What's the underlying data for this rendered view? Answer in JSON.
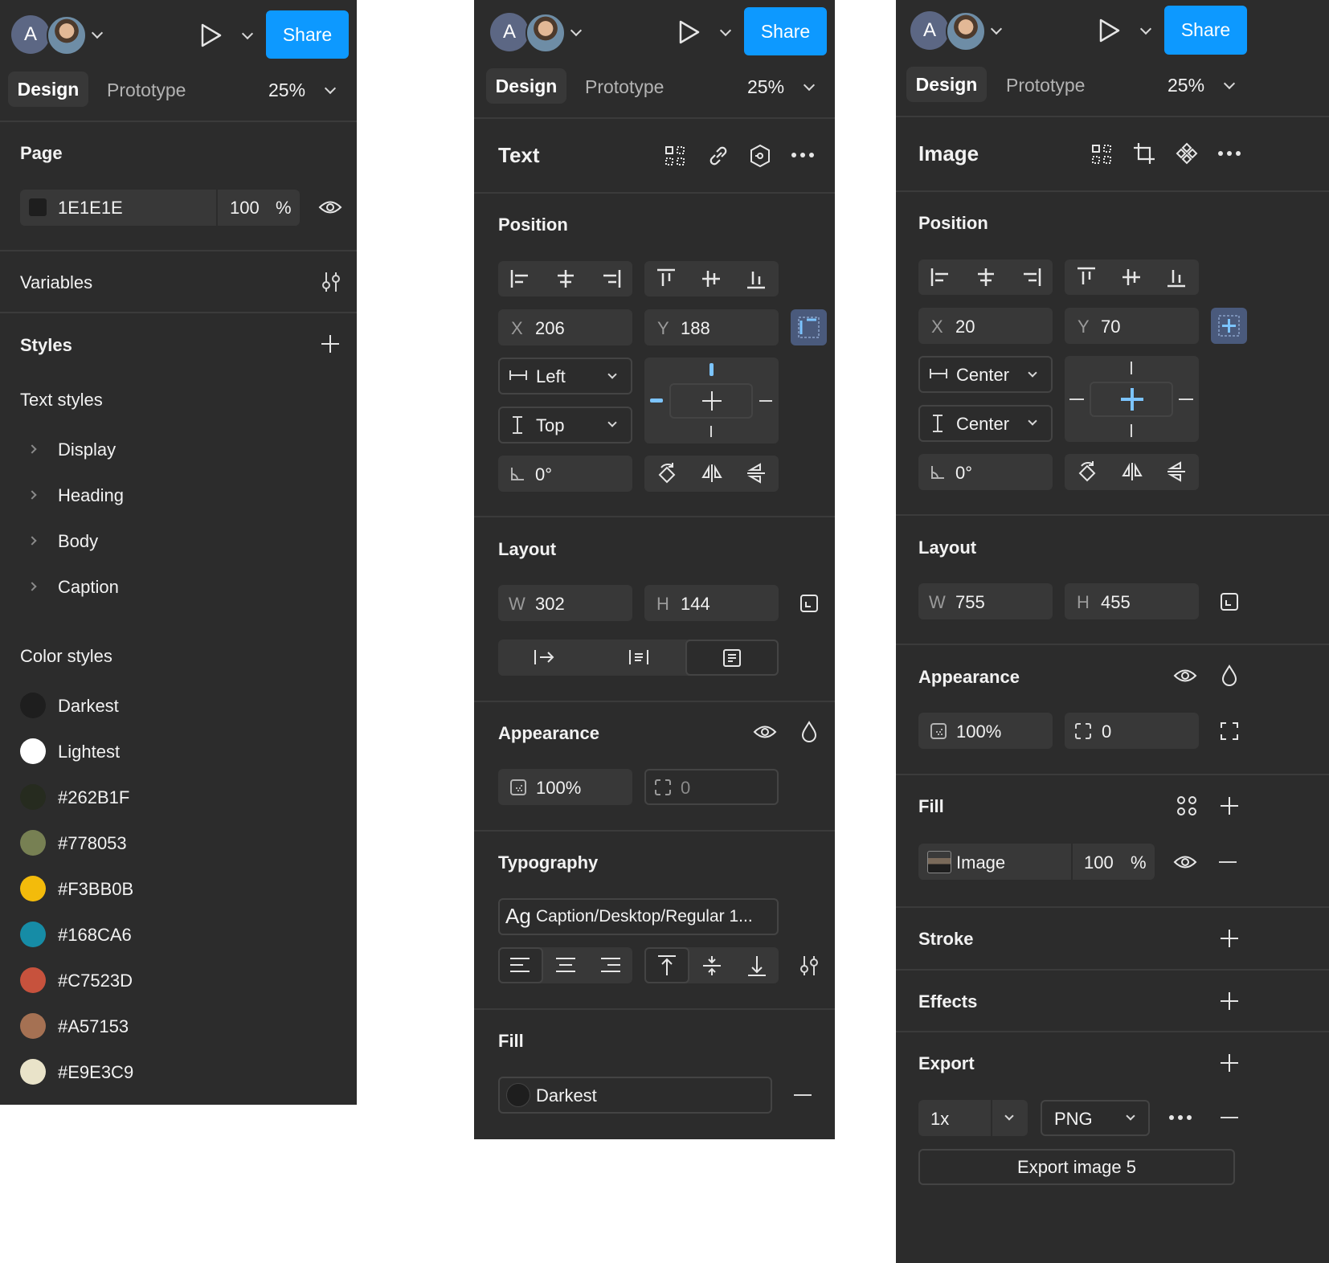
{
  "header": {
    "avatar_initial": "A",
    "share_label": "Share",
    "tabs": [
      "Design",
      "Prototype"
    ],
    "zoom": "25%"
  },
  "panel1": {
    "page_title": "Page",
    "page_color": "1E1E1E",
    "page_opacity": "100",
    "percent": "%",
    "variables": "Variables",
    "styles": "Styles",
    "text_styles_title": "Text styles",
    "text_styles": [
      "Display",
      "Heading",
      "Body",
      "Caption"
    ],
    "color_styles_title": "Color styles",
    "color_styles": [
      {
        "name": "Darkest",
        "color": "#1e1e1e"
      },
      {
        "name": "Lightest",
        "color": "#ffffff"
      },
      {
        "name": "#262B1F",
        "color": "#262B1F"
      },
      {
        "name": "#778053",
        "color": "#778053"
      },
      {
        "name": "#F3BB0B",
        "color": "#F3BB0B"
      },
      {
        "name": "#168CA6",
        "color": "#168CA6"
      },
      {
        "name": "#C7523D",
        "color": "#C7523D"
      },
      {
        "name": "#A57153",
        "color": "#A57153"
      },
      {
        "name": "#E9E3C9",
        "color": "#E9E3C9"
      }
    ]
  },
  "panel2": {
    "title": "Text",
    "position": "Position",
    "x_label": "X",
    "x_value": "206",
    "y_label": "Y",
    "y_value": "188",
    "h_constraint": "Left",
    "v_constraint": "Top",
    "rotation": "0°",
    "layout": "Layout",
    "w_label": "W",
    "w_value": "302",
    "h_label": "H",
    "h_value": "144",
    "appearance": "Appearance",
    "opacity": "100%",
    "radius": "0",
    "typography": "Typography",
    "font_prefix": "Ag",
    "font_style": "Caption/Desktop/Regular 1...",
    "fill": "Fill",
    "fill_value": "Darkest"
  },
  "panel3": {
    "title": "Image",
    "position": "Position",
    "x_label": "X",
    "x_value": "20",
    "y_label": "Y",
    "y_value": "70",
    "h_constraint": "Center",
    "v_constraint": "Center",
    "rotation": "0°",
    "layout": "Layout",
    "w_label": "W",
    "w_value": "755",
    "h_label": "H",
    "h_value": "455",
    "appearance": "Appearance",
    "opacity": "100%",
    "radius": "0",
    "fill": "Fill",
    "fill_value": "Image",
    "fill_opacity": "100",
    "percent": "%",
    "stroke": "Stroke",
    "effects": "Effects",
    "export": "Export",
    "export_scale": "1x",
    "export_format": "PNG",
    "export_button": "Export image 5"
  }
}
